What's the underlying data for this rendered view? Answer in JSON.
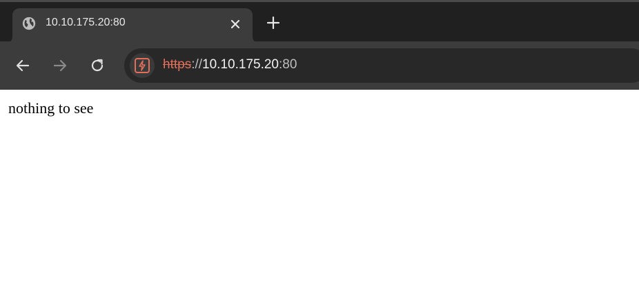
{
  "tab": {
    "title": "10.10.175.20:80",
    "favicon": "globe-icon",
    "close_icon": "close-icon"
  },
  "tabstrip": {
    "new_tab_icon": "plus-icon"
  },
  "toolbar": {
    "back_icon": "arrow-left-icon",
    "forward_icon": "arrow-right-icon",
    "reload_icon": "reload-icon",
    "forward_enabled": false
  },
  "omnibox": {
    "security_icon": "not-secure-icon",
    "scheme": "https",
    "separator": "://",
    "host": "10.10.175.20",
    "port": ":80"
  },
  "page": {
    "body_text": "nothing to see"
  },
  "colors": {
    "tabstrip_bg": "#202020",
    "active_tab_bg": "#3c3c3c",
    "toolbar_bg": "#3c3c3c",
    "omnibox_bg": "#282828",
    "warning_accent": "#e0705a",
    "page_bg": "#ffffff"
  }
}
